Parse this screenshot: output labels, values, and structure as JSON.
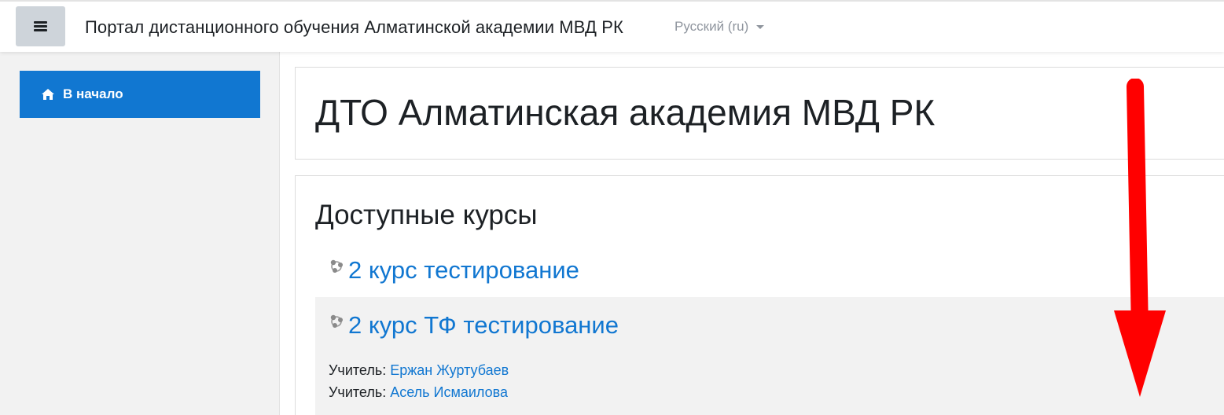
{
  "navbar": {
    "site_name": "Портал дистанционного обучения Алматинской академии МВД РК",
    "language": "Русский (ru)"
  },
  "drawer": {
    "home_label": "В начало"
  },
  "main": {
    "page_title": "ДТО Алматинская академия МВД РК",
    "section_title": "Доступные курсы",
    "courses": [
      {
        "name": "2 курс тестирование"
      },
      {
        "name": "2 курс ТФ тестирование",
        "teachers": [
          {
            "role": "Учитель:",
            "name": "Ержан Журтубаев"
          },
          {
            "role": "Учитель:",
            "name": "Асель Исмаилова"
          }
        ]
      }
    ]
  },
  "colors": {
    "accent": "#1177d1",
    "annotation_arrow": "#ff0000"
  }
}
